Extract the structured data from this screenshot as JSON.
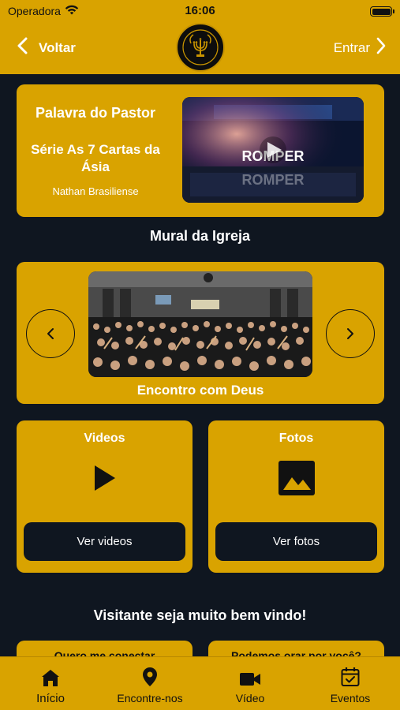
{
  "status_bar": {
    "carrier": "Operadora",
    "time": "16:06"
  },
  "nav": {
    "back_label": "Voltar",
    "login_label": "Entrar"
  },
  "pastor": {
    "section_label": "Palavra do Pastor",
    "series_title": "Série As 7 Cartas da Ásia",
    "preacher": "Nathan Brasiliense",
    "video_overlay_text": "ROMPER"
  },
  "mural": {
    "title": "Mural da Igreja",
    "caption": "Encontro com Deus"
  },
  "media": {
    "videos_title": "Videos",
    "videos_button": "Ver videos",
    "photos_title": "Fotos",
    "photos_button": "Ver fotos"
  },
  "welcome": {
    "title": "Visitante seja muito bem vindo!",
    "card_left": "Quero me conectar",
    "card_right": "Podemos orar por você?"
  },
  "tabs": [
    {
      "label": "Início",
      "icon": "home-icon"
    },
    {
      "label": "Encontre-nos",
      "icon": "location-pin-icon"
    },
    {
      "label": "Vídeo",
      "icon": "video-camera-icon"
    },
    {
      "label": "Eventos",
      "icon": "calendar-check-icon"
    }
  ],
  "colors": {
    "accent": "#d9a300",
    "background": "#0f1620",
    "text_light": "#ffffff",
    "button_dark": "#0f1620"
  }
}
